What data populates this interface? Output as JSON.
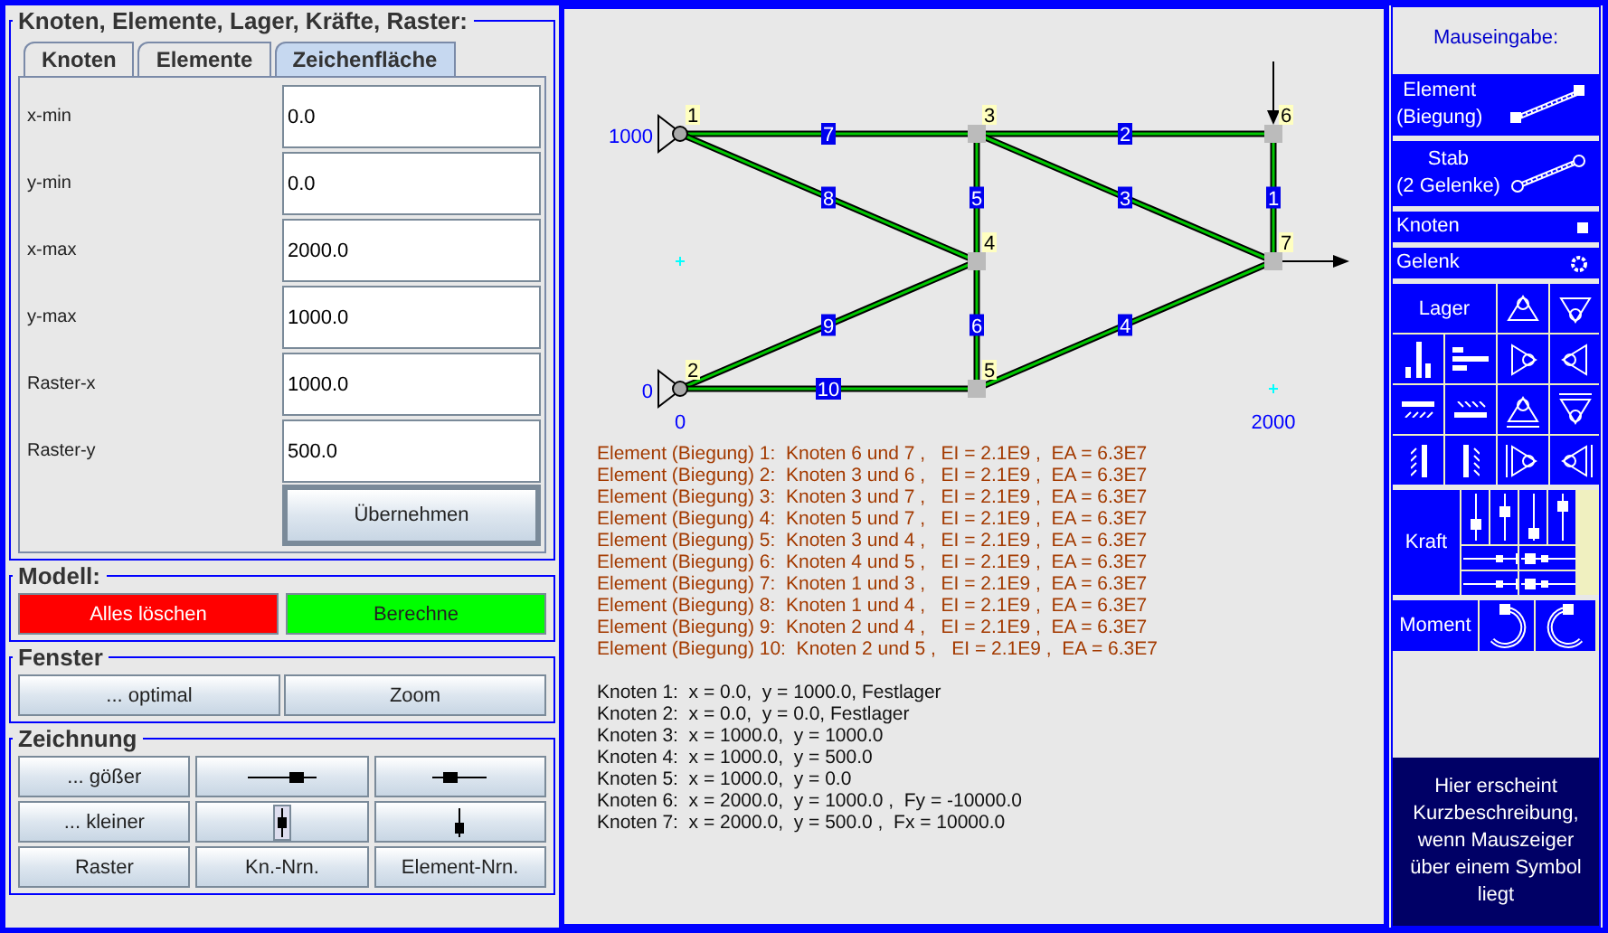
{
  "setup_panel": {
    "title": "Knoten, Elemente, Lager, Kräfte, Raster:",
    "tabs": [
      {
        "label": "Knoten",
        "selected": false
      },
      {
        "label": "Elemente",
        "selected": false
      },
      {
        "label": "Zeichenfläche",
        "selected": true
      }
    ],
    "fields": [
      {
        "label": "x-min",
        "value": "0.0"
      },
      {
        "label": "y-min",
        "value": "0.0"
      },
      {
        "label": "x-max",
        "value": "2000.0"
      },
      {
        "label": "y-max",
        "value": "1000.0"
      },
      {
        "label": "Raster-x",
        "value": "1000.0"
      },
      {
        "label": "Raster-y",
        "value": "500.0"
      }
    ],
    "apply_button": "Übernehmen"
  },
  "model_panel": {
    "title": "Modell:",
    "buttons": [
      {
        "label": "Alles löschen",
        "color": "#ff0000"
      },
      {
        "label": "Berechne",
        "color": "#00ff00"
      }
    ]
  },
  "window_panel": {
    "title": "Fenster",
    "buttons": [
      "... optimal",
      "Zoom"
    ]
  },
  "drawing_panel": {
    "title": "Zeichnung",
    "buttons": [
      {
        "kind": "text",
        "label": "... gößer"
      },
      {
        "kind": "widen",
        "pressed": false
      },
      {
        "kind": "narrow",
        "pressed": false
      },
      {
        "kind": "text",
        "label": "... kleiner"
      },
      {
        "kind": "stretch",
        "pressed": true
      },
      {
        "kind": "squash",
        "pressed": false
      },
      {
        "kind": "text",
        "label": "Raster"
      },
      {
        "kind": "text",
        "label": "Kn.-Nrn."
      },
      {
        "kind": "text",
        "label": "Element-Nrn."
      }
    ]
  },
  "canvas": {
    "nodes": [
      {
        "label": "1",
        "support": true,
        "load": false
      },
      {
        "label": "3",
        "support": false,
        "load": false
      },
      {
        "label": "6",
        "support": false,
        "load": true
      },
      {
        "label": "4",
        "support": false,
        "load": false
      },
      {
        "label": "7",
        "support": false,
        "load": true
      },
      {
        "label": "2",
        "support": true,
        "load": false
      },
      {
        "label": "5",
        "support": false,
        "load": false
      }
    ],
    "element_numbers": [
      "7",
      "2",
      "8",
      "5",
      "3",
      "1",
      "9",
      "6",
      "4",
      "10"
    ],
    "axis_labels": [
      "1000",
      "0",
      "0",
      "2000"
    ],
    "element_lines": [
      "Element (Biegung) 1:  Knoten 6 und 7 ,   EI = 2.1E9 ,  EA = 6.3E7",
      "Element (Biegung) 2:  Knoten 3 und 6 ,   EI = 2.1E9 ,  EA = 6.3E7",
      "Element (Biegung) 3:  Knoten 3 und 7 ,   EI = 2.1E9 ,  EA = 6.3E7",
      "Element (Biegung) 4:  Knoten 5 und 7 ,   EI = 2.1E9 ,  EA = 6.3E7",
      "Element (Biegung) 5:  Knoten 3 und 4 ,   EI = 2.1E9 ,  EA = 6.3E7",
      "Element (Biegung) 6:  Knoten 4 und 5 ,   EI = 2.1E9 ,  EA = 6.3E7",
      "Element (Biegung) 7:  Knoten 1 und 3 ,   EI = 2.1E9 ,  EA = 6.3E7",
      "Element (Biegung) 8:  Knoten 1 und 4 ,   EI = 2.1E9 ,  EA = 6.3E7",
      "Element (Biegung) 9:  Knoten 2 und 4 ,   EI = 2.1E9 ,  EA = 6.3E7",
      "Element (Biegung) 10:  Knoten 2 und 5 ,   EI = 2.1E9 ,  EA = 6.3E7"
    ],
    "node_lines": [
      "Knoten 1:  x = 0.0,  y = 1000.0, Festlager",
      "Knoten 2:  x = 0.0,  y = 0.0, Festlager",
      "Knoten 3:  x = 1000.0,  y = 1000.0",
      "Knoten 4:  x = 1000.0,  y = 500.0",
      "Knoten 5:  x = 1000.0,  y = 0.0",
      "Knoten 6:  x = 2000.0,  y = 1000.0 ,  Fy = -10000.0",
      "Knoten 7:  x = 2000.0,  y = 500.0 ,  Fx = 10000.0"
    ]
  },
  "palette": {
    "title": "Mauseingabe:",
    "element_tool": [
      "Element",
      "(Biegung)"
    ],
    "bar_tool": [
      "Stab",
      "(2 Gelenke)"
    ],
    "node_tool": "Knoten",
    "hinge_tool": "Gelenk",
    "support_label": "Lager",
    "force_label": "Kraft",
    "moment_label": "Moment",
    "hint": "Hier erscheint Kurzbeschreibung, wenn Mauszeiger über einem Symbol liegt"
  }
}
